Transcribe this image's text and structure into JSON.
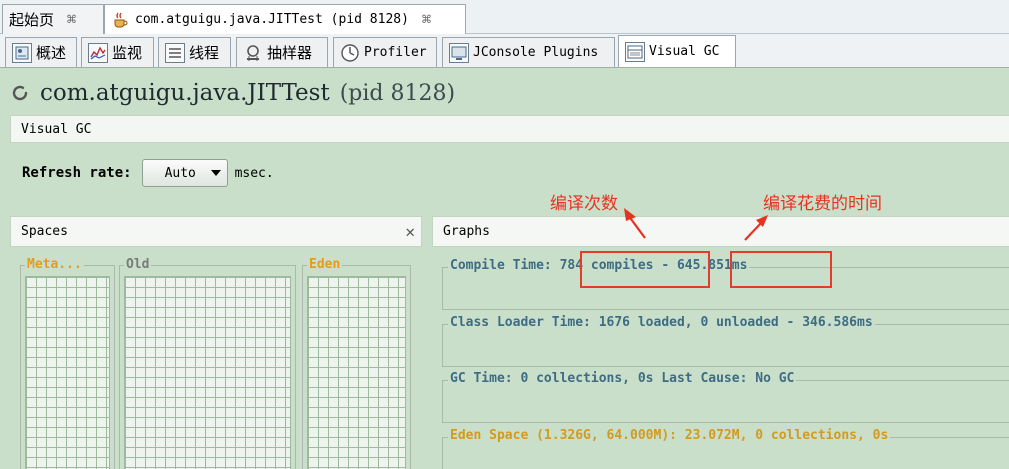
{
  "doc_tabs": [
    {
      "label": "起始页",
      "close": "⌘"
    },
    {
      "label": "com.atguigu.java.JITTest (pid 8128)",
      "close": "⌘"
    }
  ],
  "view_tabs": [
    {
      "label": "概述",
      "icon": "overview-icon"
    },
    {
      "label": "监视",
      "icon": "monitor-icon"
    },
    {
      "label": "线程",
      "icon": "threads-icon"
    },
    {
      "label": "抽样器",
      "icon": "sampler-icon"
    },
    {
      "label": "Profiler",
      "icon": "profiler-icon"
    },
    {
      "label": "JConsole Plugins",
      "icon": "jconsole-icon"
    },
    {
      "label": "Visual GC",
      "icon": "visualgc-icon"
    }
  ],
  "header": {
    "app_name": "com.atguigu.java.JITTest",
    "pid": "(pid 8128)"
  },
  "visual_gc_label": "Visual GC",
  "refresh": {
    "label": "Refresh rate:",
    "value": "Auto",
    "unit": "msec."
  },
  "spaces_panel": {
    "title": "Spaces",
    "close": "✕",
    "columns": [
      {
        "label": "Meta...",
        "color": "#e89a1a"
      },
      {
        "label": "Old",
        "color": "#7a7a7a"
      },
      {
        "label": "Eden",
        "color": "#e89a1a"
      }
    ]
  },
  "graphs_panel": {
    "title": "Graphs",
    "compile_time": {
      "prefix": "Compile Time:",
      "compiles": "784 compiles",
      "sep": "-",
      "time": "645.851ms"
    },
    "class_loader": "Class Loader Time: 1676 loaded, 0 unloaded - 346.586ms",
    "gc_time": "GC Time: 0 collections, 0s Last Cause: No GC",
    "eden_space": "Eden Space (1.326G, 64.000M): 23.072M, 0 collections, 0s"
  },
  "annotations": {
    "compile_count": "编译次数",
    "compile_cost": "编译花费的时间"
  },
  "colors": {
    "background_green": "#c9dfca",
    "graph_title_blue": "#3d6c84",
    "eden_orange": "#d39a1f",
    "annotation_red": "#e8321f"
  }
}
